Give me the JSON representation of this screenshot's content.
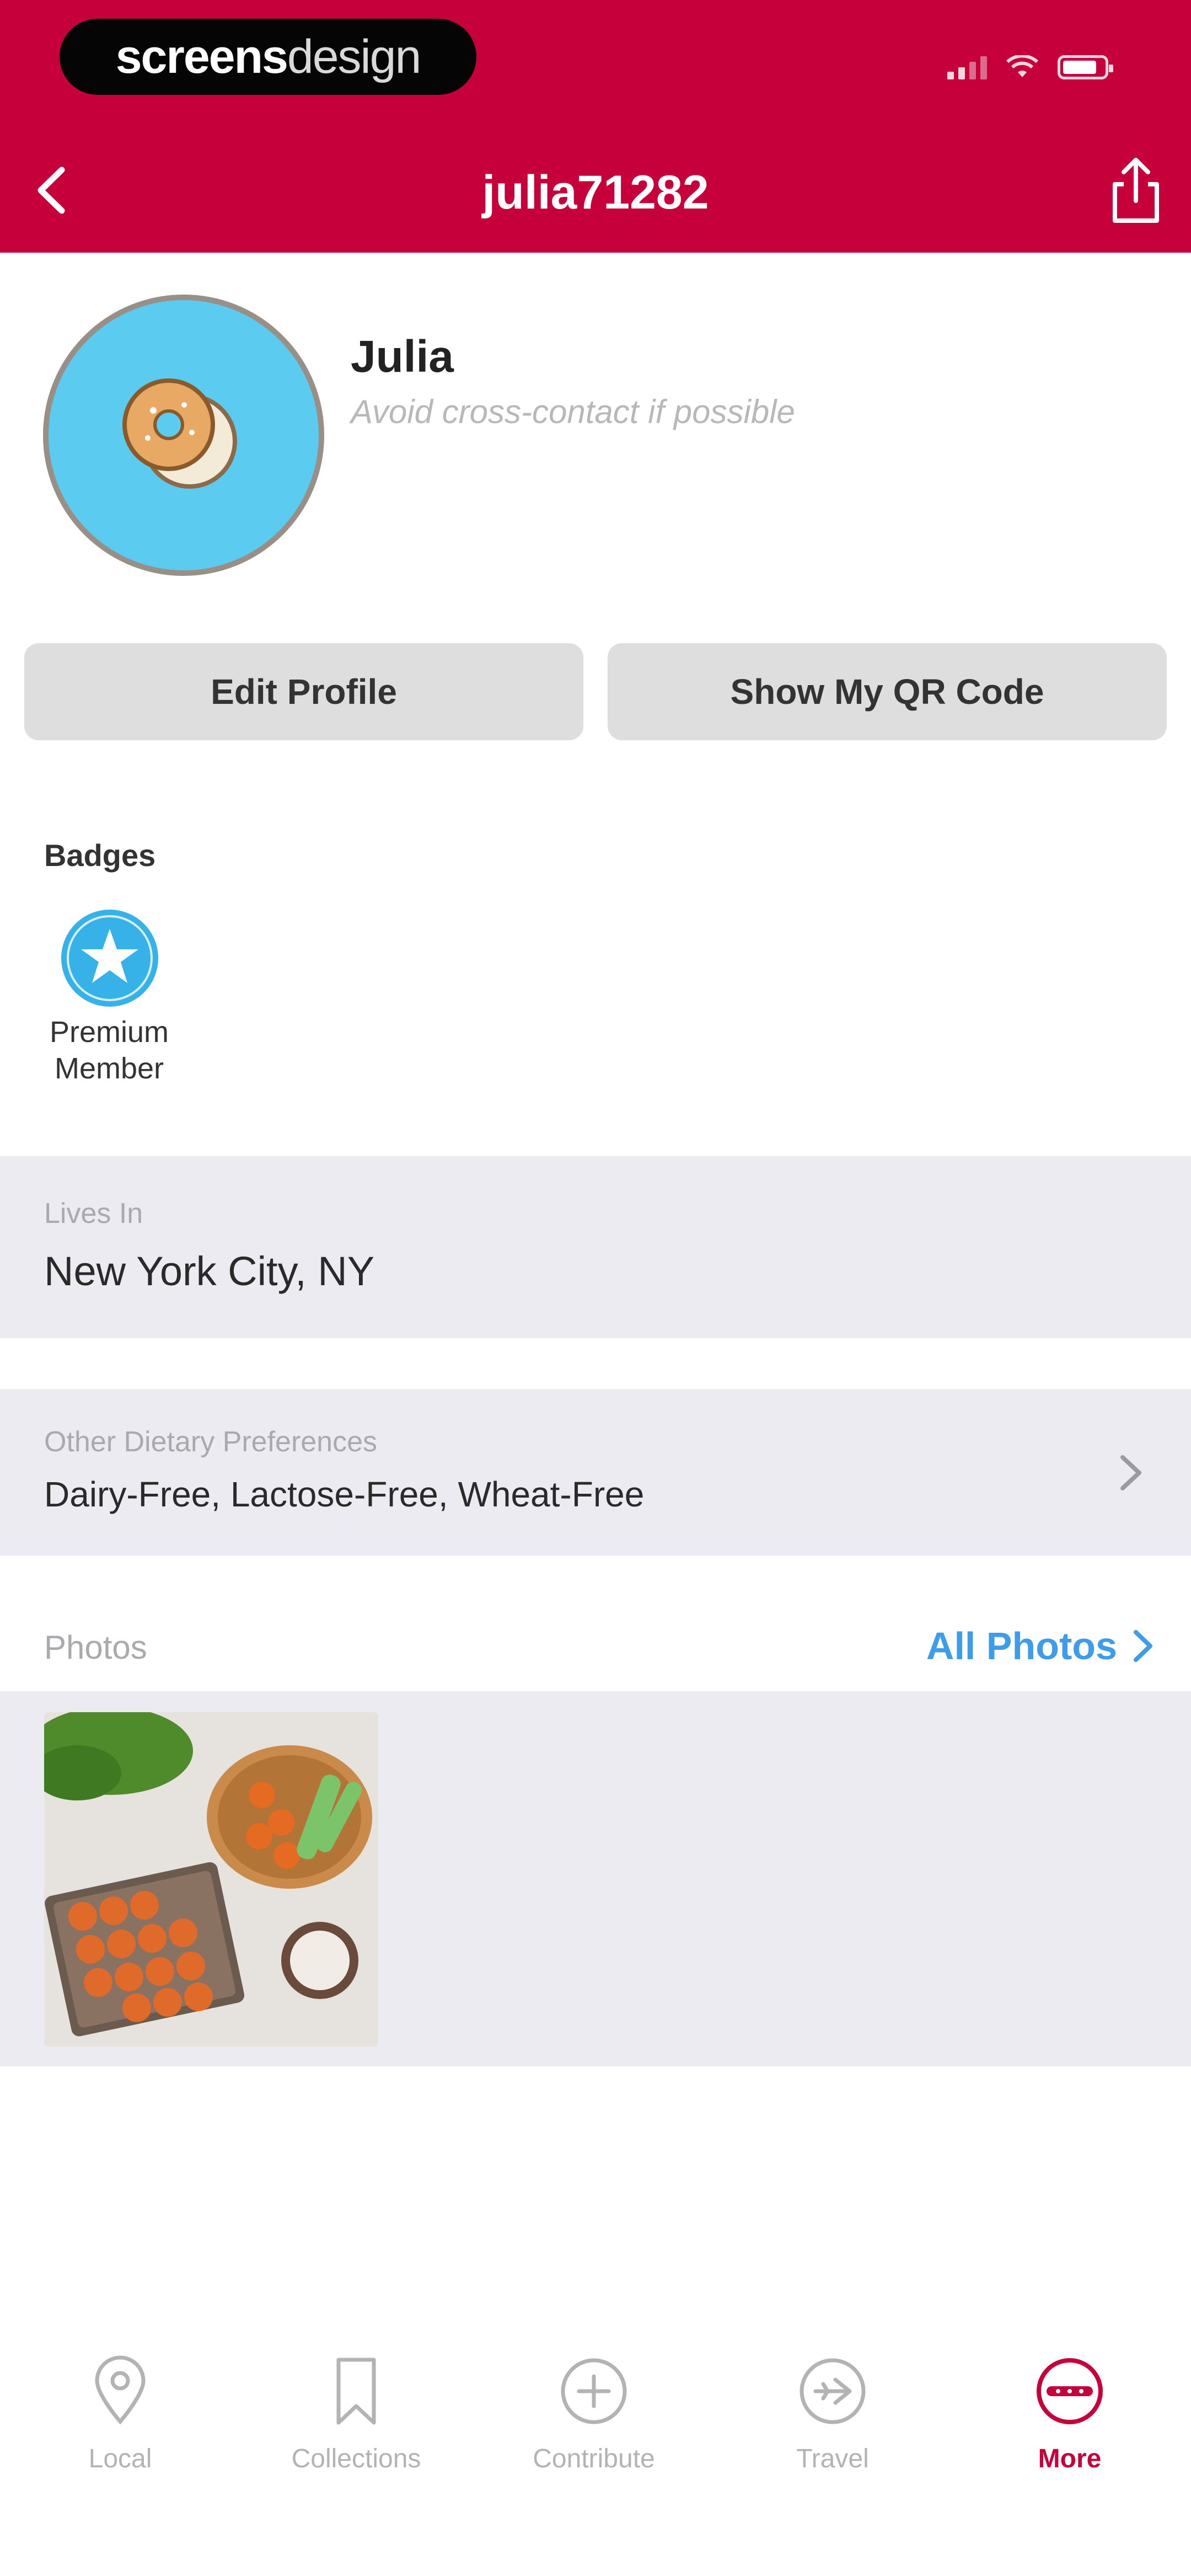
{
  "status_bar": {
    "brand_bold": "screens",
    "brand_light": "design"
  },
  "nav": {
    "title": "julia71282"
  },
  "profile": {
    "name": "Julia",
    "bio": "Avoid cross-contact if possible"
  },
  "buttons": {
    "edit_profile": "Edit Profile",
    "qr_code": "Show My QR Code"
  },
  "badges": {
    "heading": "Badges",
    "items": [
      {
        "icon": "star-badge-icon",
        "label_line1": "Premium",
        "label_line2": "Member"
      }
    ]
  },
  "lives_in": {
    "label": "Lives In",
    "value": "New York City, NY"
  },
  "dietary": {
    "label": "Other Dietary Preferences",
    "value": "Dairy-Free, Lactose-Free, Wheat-Free"
  },
  "photos": {
    "label": "Photos",
    "all_link": "All Photos"
  },
  "tabs": [
    {
      "label": "Local",
      "icon": "map-pin-icon"
    },
    {
      "label": "Collections",
      "icon": "bookmark-icon"
    },
    {
      "label": "Contribute",
      "icon": "plus-circle-icon"
    },
    {
      "label": "Travel",
      "icon": "plane-circle-icon"
    },
    {
      "label": "More",
      "icon": "more-circle-icon"
    }
  ],
  "colors": {
    "brand": "#c5003a",
    "link": "#3f9ce8",
    "avatar_bg": "#5bcbf0",
    "band_bg": "#ecebf1"
  }
}
